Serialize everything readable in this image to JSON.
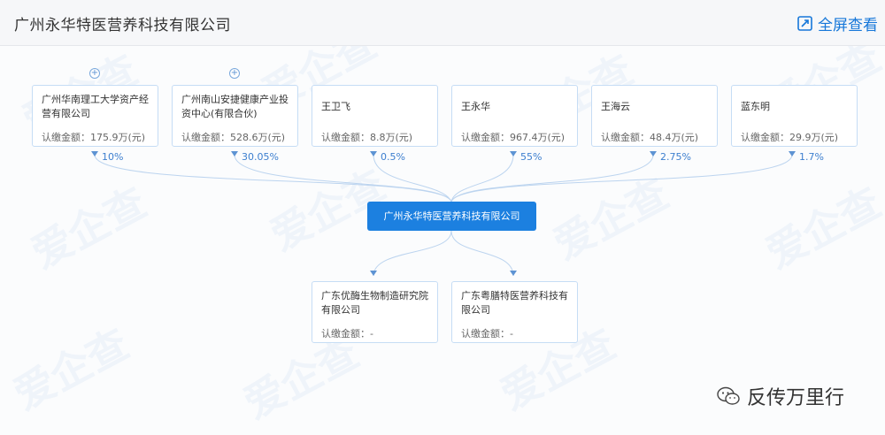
{
  "header": {
    "title": "广州永华特医营养科技有限公司",
    "fullscreen_label": "全屏查看"
  },
  "watermark_text": "爱企查",
  "shareholders": [
    {
      "name": "广州华南理工大学资产经营有限公司",
      "amount": "认缴金额：175.9万(元)",
      "percent": "10%",
      "expandable": true
    },
    {
      "name": "广州南山安捷健康产业投资中心(有限合伙)",
      "amount": "认缴金额：528.6万(元)",
      "percent": "30.05%",
      "expandable": true
    },
    {
      "name": "王卫飞",
      "amount": "认缴金额：8.8万(元)",
      "percent": "0.5%",
      "expandable": false
    },
    {
      "name": "王永华",
      "amount": "认缴金额：967.4万(元)",
      "percent": "55%",
      "expandable": false
    },
    {
      "name": "王海云",
      "amount": "认缴金额：48.4万(元)",
      "percent": "2.75%",
      "expandable": false
    },
    {
      "name": "蓝东明",
      "amount": "认缴金额：29.9万(元)",
      "percent": "1.7%",
      "expandable": false
    }
  ],
  "center_company": "广州永华特医营养科技有限公司",
  "investments": [
    {
      "name": "广东优酶生物制造研究院有限公司",
      "amount": "认缴金额：-"
    },
    {
      "name": "广东粤膳特医营养科技有限公司",
      "amount": "认缴金额：-"
    }
  ],
  "expand_symbol": "+",
  "wechat_label": "反传万里行",
  "colors": {
    "accent": "#1c80e0",
    "link": "#1677d9",
    "node_border": "#c6ddf5"
  }
}
